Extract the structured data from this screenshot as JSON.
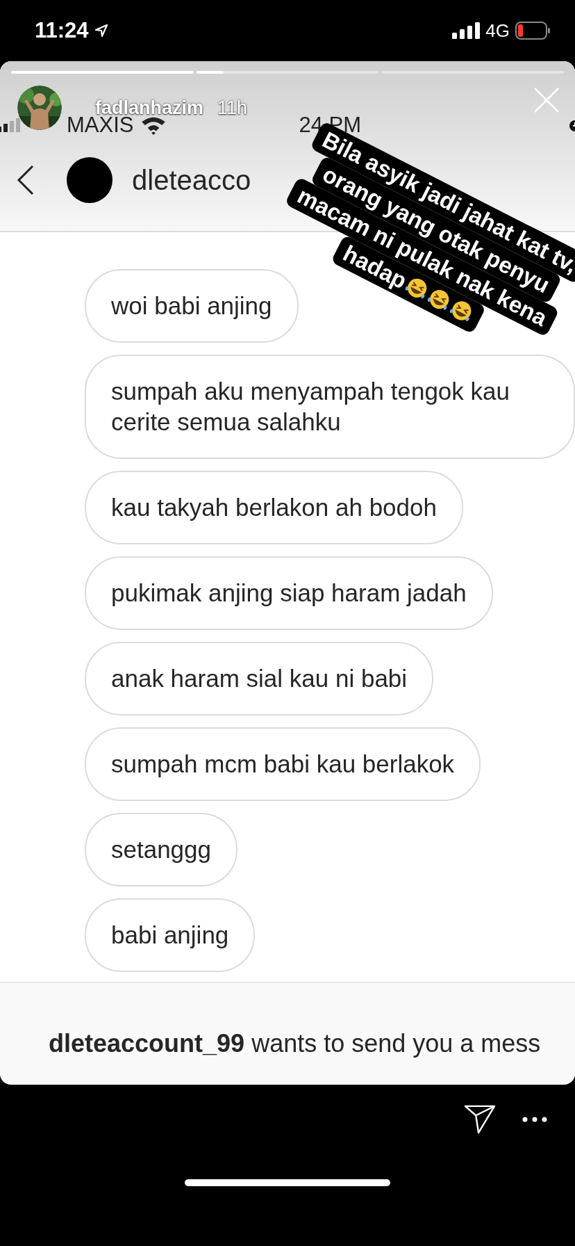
{
  "status_bar": {
    "time": "11:24",
    "network": "4G"
  },
  "story": {
    "progress": [
      {
        "kind": "bar",
        "level": 1
      },
      {
        "kind": "bar",
        "level": 0.15
      },
      {
        "kind": "empty"
      }
    ],
    "author": {
      "username": "fadlanhazim",
      "age": "11h"
    }
  },
  "screenshot": {
    "status_bar": {
      "carrier": "MAXIS",
      "time": "24 PM"
    },
    "chat_header": {
      "username": "dleteacco"
    },
    "messages": [
      {
        "text": "woi babi anjing"
      },
      {
        "text": "sumpah aku menyampah tengok kau cerite semua salahku"
      },
      {
        "text": "kau takyah berlakon ah bodoh"
      },
      {
        "text": "pukimak anjing siap haram jadah"
      },
      {
        "text": "anak haram sial kau ni babi"
      },
      {
        "text": "sumpah mcm babi kau berlakok"
      },
      {
        "text": "setanggg"
      },
      {
        "text": "babi anjing"
      }
    ],
    "request_banner": {
      "username": "dleteaccount_99",
      "text": "wants to send you a mess"
    }
  },
  "caption": {
    "lines": [
      {
        "text": "Bila asyik jadi jahat kat tv,"
      },
      {
        "text": "orang yang otak penyu"
      },
      {
        "text": "macam ni pulak nak kena"
      },
      {
        "text": "hadap",
        "emojis": [
          {
            "kind": "laughing"
          },
          {
            "kind": "laughing"
          },
          {
            "kind": "laughing"
          }
        ]
      }
    ]
  }
}
